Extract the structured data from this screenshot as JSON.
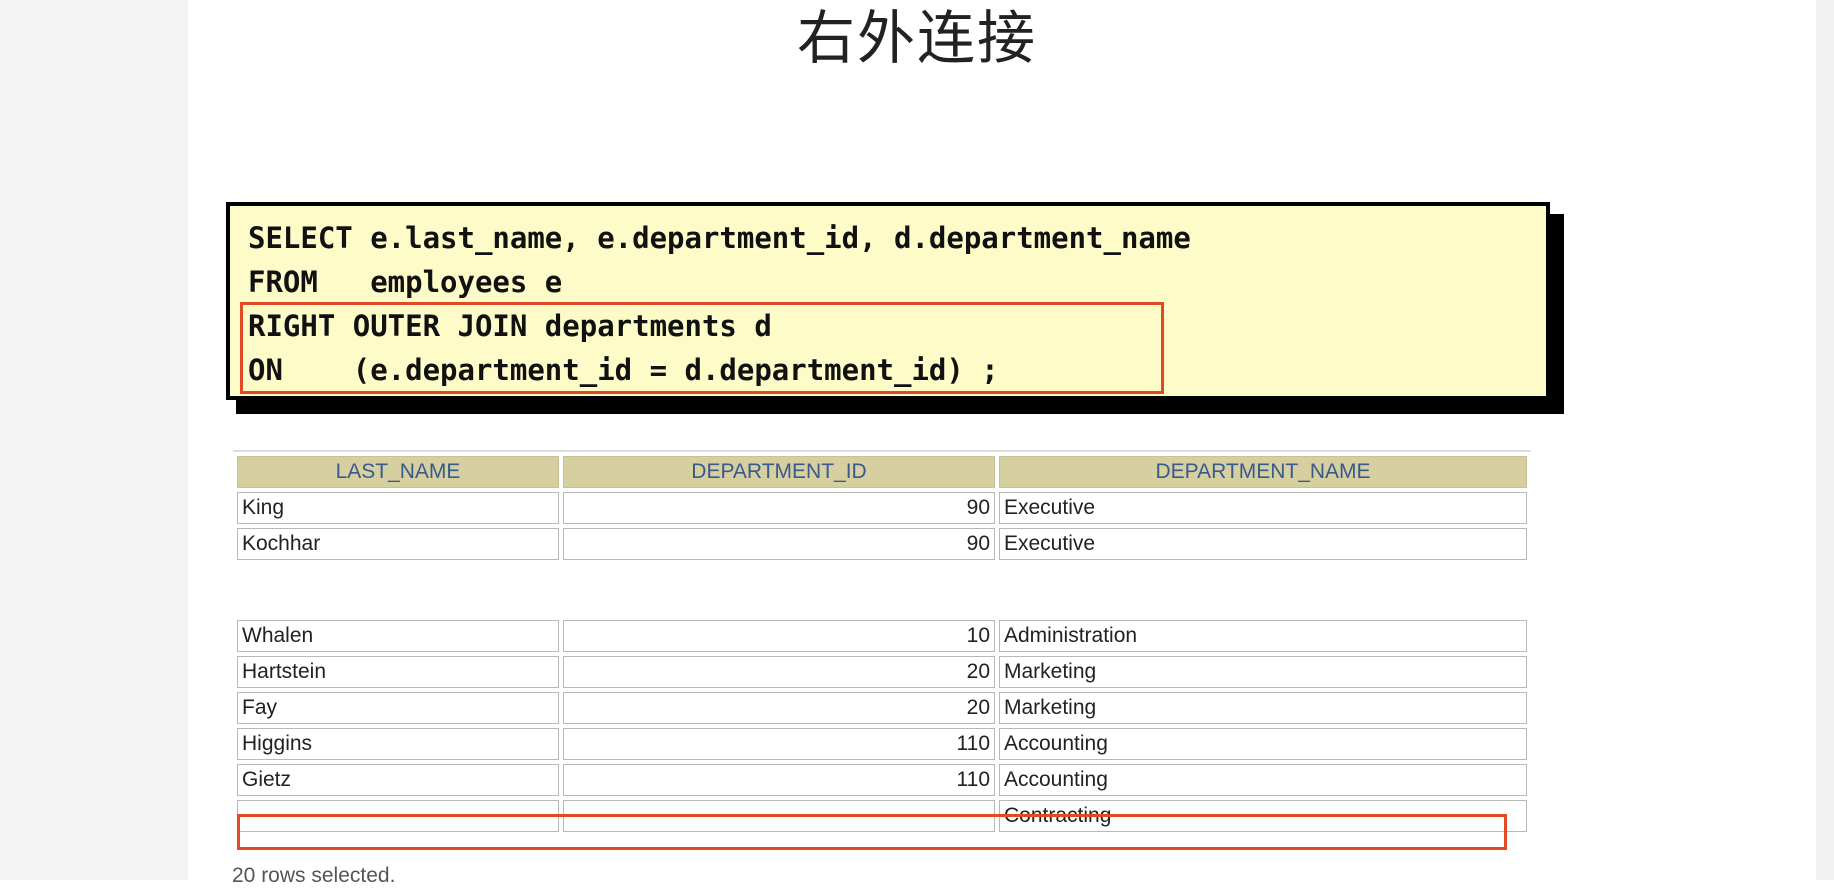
{
  "slide": {
    "title": "右外连接",
    "sql_lines": [
      "SELECT e.last_name, e.department_id, d.department_name",
      "FROM   employees e",
      "RIGHT OUTER JOIN departments d",
      "ON    (e.department_id = d.department_id) ;"
    ],
    "columns": [
      "LAST_NAME",
      "DEPARTMENT_ID",
      "DEPARTMENT_NAME"
    ],
    "rows_top": [
      {
        "last_name": "King",
        "department_id": "90",
        "department_name": "Executive"
      },
      {
        "last_name": "Kochhar",
        "department_id": "90",
        "department_name": "Executive"
      }
    ],
    "rows_bottom": [
      {
        "last_name": "Whalen",
        "department_id": "10",
        "department_name": "Administration"
      },
      {
        "last_name": "Hartstein",
        "department_id": "20",
        "department_name": "Marketing"
      },
      {
        "last_name": "Fay",
        "department_id": "20",
        "department_name": "Marketing"
      },
      {
        "last_name": "Higgins",
        "department_id": "110",
        "department_name": "Accounting"
      },
      {
        "last_name": "Gietz",
        "department_id": "110",
        "department_name": "Accounting"
      },
      {
        "last_name": "",
        "department_id": "",
        "department_name": "Contracting"
      }
    ],
    "footer": "20 rows selected."
  },
  "colors": {
    "code_background": "#fdfcc8",
    "highlight": "#e04a26",
    "header_background": "#d6cfa0",
    "header_text": "#3a5a8c"
  }
}
